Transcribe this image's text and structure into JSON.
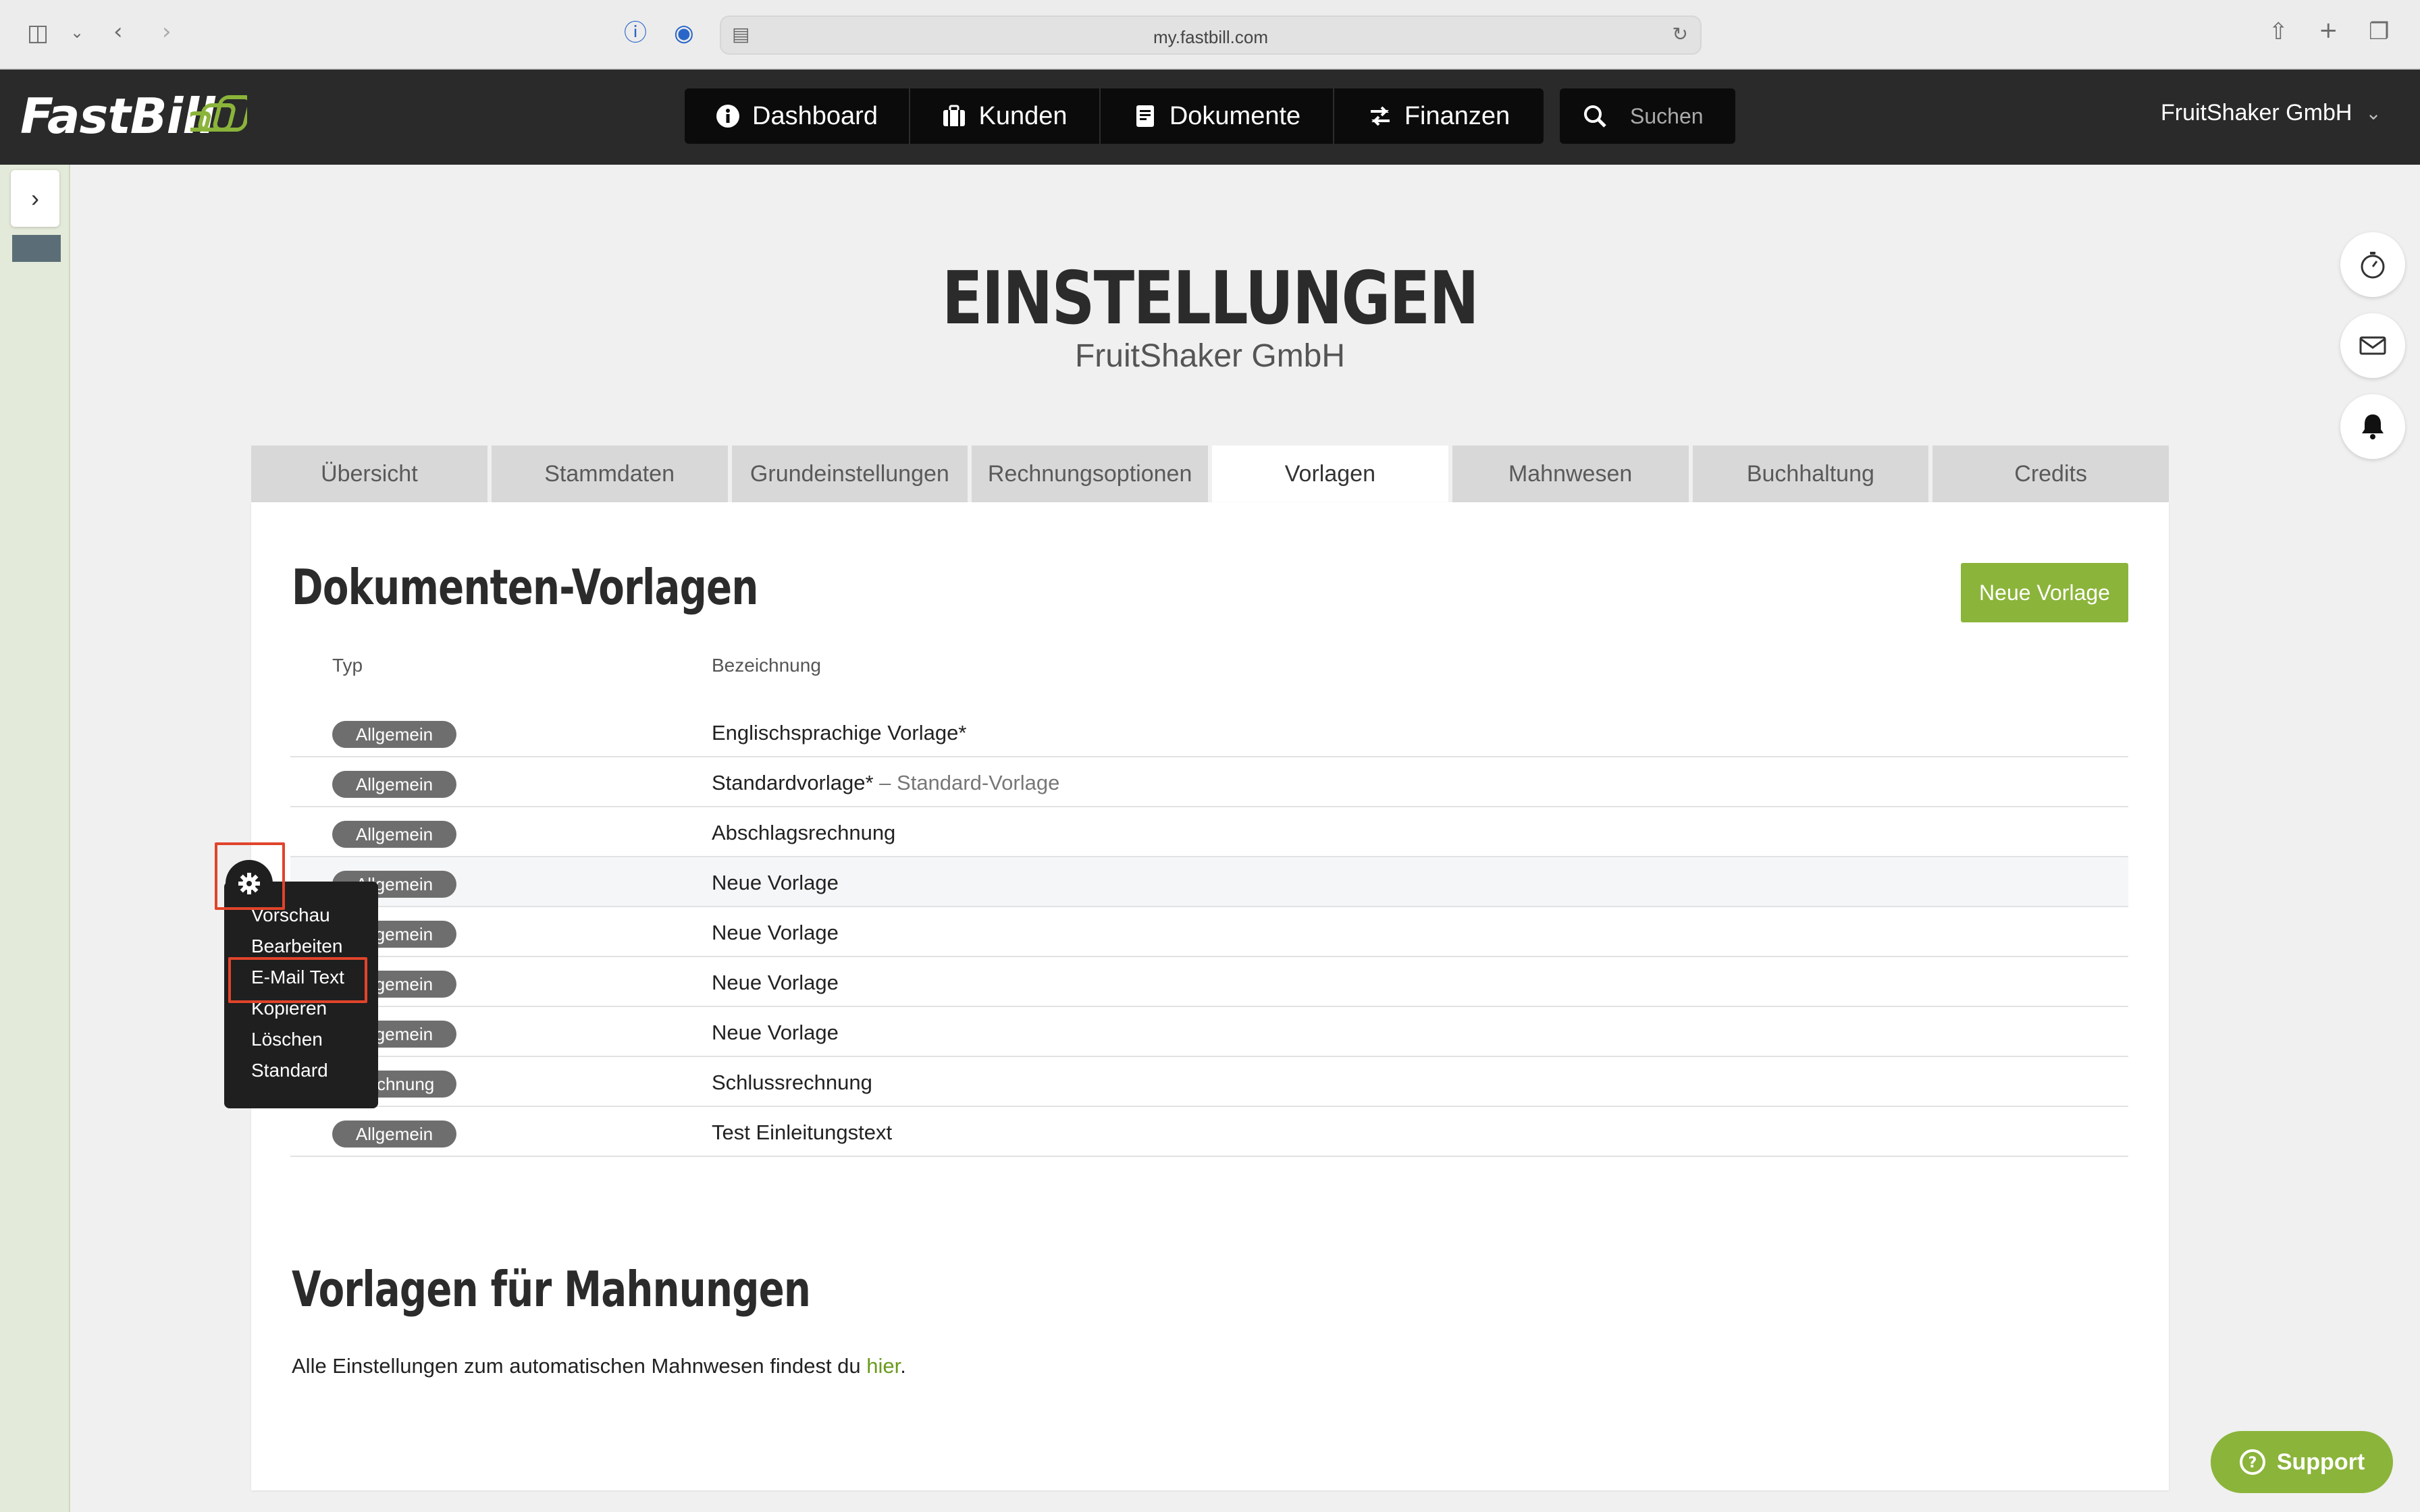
{
  "browser": {
    "url": "my.fastbill.com"
  },
  "header": {
    "logo_text": "FastBill",
    "nav": [
      {
        "label": "Dashboard",
        "icon": "info-icon"
      },
      {
        "label": "Kunden",
        "icon": "briefcase-icon"
      },
      {
        "label": "Dokumente",
        "icon": "document-icon"
      },
      {
        "label": "Finanzen",
        "icon": "transfer-arrows-icon"
      }
    ],
    "search_placeholder": "Suchen",
    "company": "FruitShaker GmbH"
  },
  "page": {
    "title": "EINSTELLUNGEN",
    "subtitle": "FruitShaker GmbH"
  },
  "tabs": [
    {
      "label": "Übersicht",
      "active": false
    },
    {
      "label": "Stammdaten",
      "active": false
    },
    {
      "label": "Grundeinstellungen",
      "active": false
    },
    {
      "label": "Rechnungsoptionen",
      "active": false
    },
    {
      "label": "Vorlagen",
      "active": true
    },
    {
      "label": "Mahnwesen",
      "active": false
    },
    {
      "label": "Buchhaltung",
      "active": false
    },
    {
      "label": "Credits",
      "active": false
    }
  ],
  "templates": {
    "title": "Dokumenten-Vorlagen",
    "new_button": "Neue Vorlage",
    "columns": {
      "type": "Typ",
      "name": "Bezeichnung"
    },
    "rows": [
      {
        "type": "Allgemein",
        "name": "Englischsprachige Vorlage*",
        "extra": ""
      },
      {
        "type": "Allgemein",
        "name": "Standardvorlage*",
        "extra": " – Standard-Vorlage"
      },
      {
        "type": "Allgemein",
        "name": "Abschlagsrechnung",
        "extra": ""
      },
      {
        "type": "Allgemein",
        "name": "Neue Vorlage",
        "extra": ""
      },
      {
        "type": "Allgemein",
        "name": "Neue Vorlage",
        "extra": ""
      },
      {
        "type": "Allgemein",
        "name": "Neue Vorlage",
        "extra": ""
      },
      {
        "type": "Allgemein",
        "name": "Neue Vorlage",
        "extra": ""
      },
      {
        "type": "Rechnung",
        "name": "Schlussrechnung",
        "extra": ""
      },
      {
        "type": "Allgemein",
        "name": "Test Einleitungstext",
        "extra": ""
      }
    ]
  },
  "context_menu": {
    "items": [
      "Vorschau",
      "Bearbeiten",
      "E-Mail Text",
      "Kopieren",
      "Löschen",
      "Standard"
    ],
    "highlighted": "E-Mail Text"
  },
  "reminders": {
    "title": "Vorlagen für Mahnungen",
    "text_before": "Alle Einstellungen zum automatischen Mahnwesen findest du ",
    "link": "hier",
    "text_after": "."
  },
  "side_actions": [
    "timer-icon",
    "mail-icon",
    "bell-icon"
  ],
  "support": {
    "label": "Support"
  },
  "colors": {
    "accent_green": "#8bb43a",
    "header_bg": "#2a2a2a",
    "highlight_red": "#e0442a"
  }
}
